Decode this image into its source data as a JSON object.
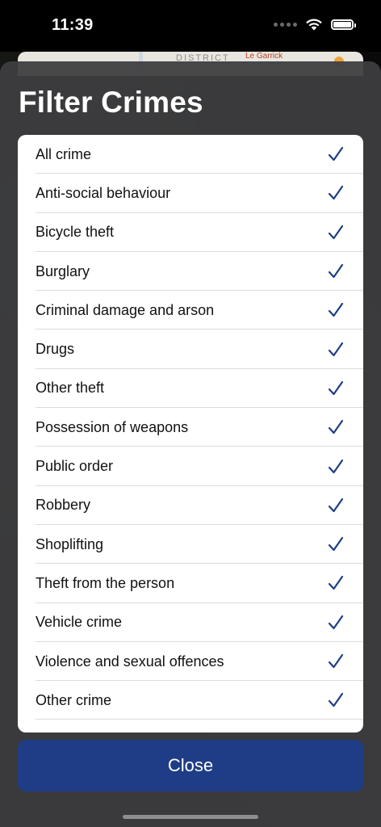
{
  "status_bar": {
    "time": "11:39"
  },
  "map": {
    "district_label": "DISTRICT",
    "poi_label": "Le Garrick"
  },
  "sheet": {
    "title": "Filter Crimes",
    "close_label": "Close",
    "accent_color": "#1f3d86",
    "check_icon": "checkmark-icon"
  },
  "filters": [
    {
      "label": "All crime",
      "checked": true
    },
    {
      "label": "Anti-social behaviour",
      "checked": true
    },
    {
      "label": "Bicycle theft",
      "checked": true
    },
    {
      "label": "Burglary",
      "checked": true
    },
    {
      "label": "Criminal damage and arson",
      "checked": true
    },
    {
      "label": "Drugs",
      "checked": true
    },
    {
      "label": "Other theft",
      "checked": true
    },
    {
      "label": "Possession of weapons",
      "checked": true
    },
    {
      "label": "Public order",
      "checked": true
    },
    {
      "label": "Robbery",
      "checked": true
    },
    {
      "label": "Shoplifting",
      "checked": true
    },
    {
      "label": "Theft from the person",
      "checked": true
    },
    {
      "label": "Vehicle crime",
      "checked": true
    },
    {
      "label": "Violence and sexual offences",
      "checked": true
    },
    {
      "label": "Other crime",
      "checked": true
    }
  ]
}
